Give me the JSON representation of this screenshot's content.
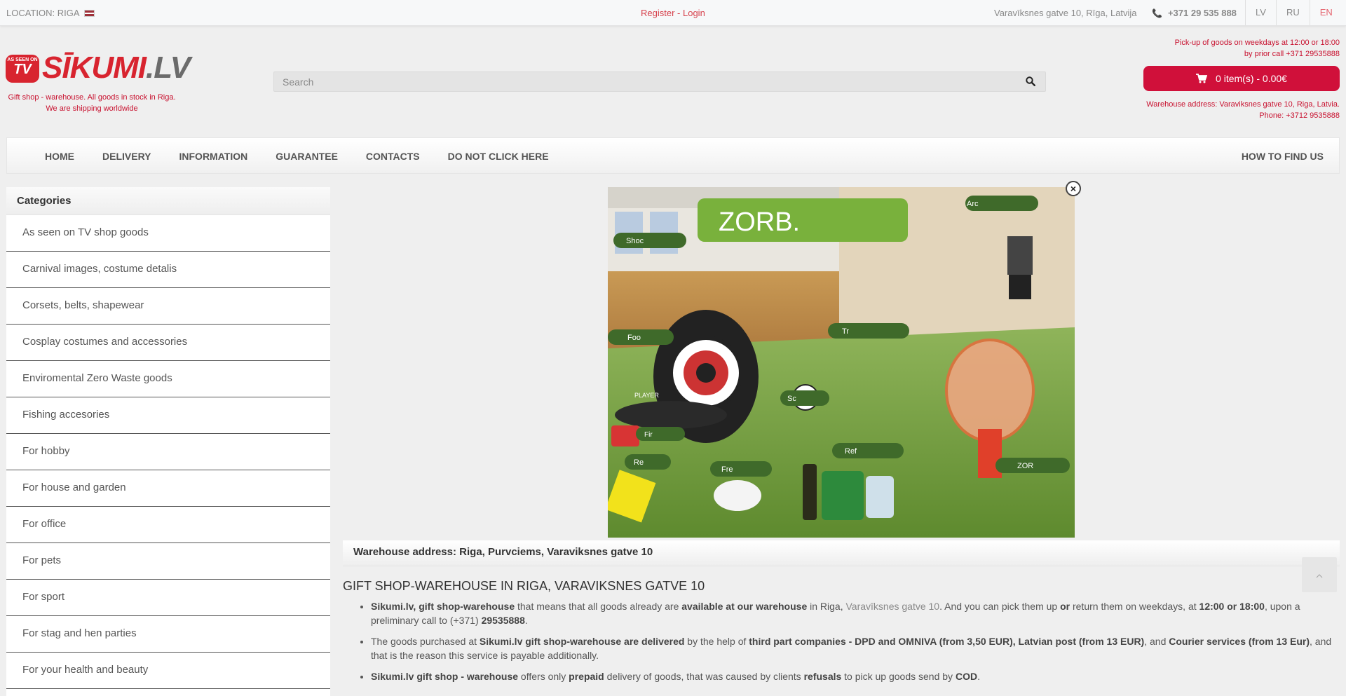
{
  "topbar": {
    "location": "LOCATION: RIGA",
    "register": "Register",
    "sep": " - ",
    "login": "Login",
    "address": "Varavīksnes gatve 10, Rīga, Latvija",
    "phone": "+371 29 535 888",
    "langs": [
      "LV",
      "RU",
      "EN"
    ],
    "active_lang": "EN"
  },
  "header": {
    "logo_small": "AS SEEN ON",
    "logo_tv": "TV",
    "logo_main": "SĪKUMI",
    "logo_suffix": ".LV",
    "tagline_1": "Gift shop - warehouse. All goods in stock in Riga.",
    "tagline_2": "We are shipping worldwide",
    "search_placeholder": "Search",
    "pickup_1": "Pick-up of goods on weekdays at 12:00 or 18:00",
    "pickup_2": "by prior call +371 29535888",
    "cart_label": "0 item(s) - 0.00€",
    "warehouse_1": "Warehouse address: Varaviksnes gatve 10, Riga, Latvia.",
    "warehouse_2": "Phone: +3712 9535888"
  },
  "nav": {
    "items": [
      "HOME",
      "DELIVERY",
      "INFORMATION",
      "GUARANTEE",
      "CONTACTS",
      "DO NOT CLICK HERE"
    ],
    "right": "HOW TO FIND US"
  },
  "sidebar": {
    "title": "Categories",
    "items": [
      "As seen on TV shop goods",
      "Carnival images, costume detalis",
      "Corsets, belts, shapewear",
      "Cosplay costumes and accessories",
      "Enviromental Zero Waste goods",
      "Fishing accesories",
      "For hobby",
      "For house and garden",
      "For office",
      "For pets",
      "For sport",
      "For stag and hen parties",
      "For your health and beauty"
    ]
  },
  "banner": {
    "headline": "ZORB.",
    "bubbles": [
      "Shoc",
      "Arc",
      "Foo",
      "Tr",
      "Sc",
      "Fir",
      "Re",
      "Fre",
      "Ref",
      "ZOR"
    ],
    "dart_text": "PLAYER",
    "close": "×"
  },
  "main": {
    "warehouse_bar": "Warehouse address: Riga, Purvciems, Varaviksnes gatve 10",
    "heading": "GIFT SHOP-WAREHOUSE IN RIGA, VARAVIKSNES GATVE 10",
    "p1": {
      "a": "Sikumi.lv, gift shop-warehouse",
      "b": " that means that all goods already are ",
      "c": "available at our warehouse",
      "d": " in Riga, ",
      "e": "Varavīksnes gatve 10",
      "f": ". And you can pick them up ",
      "g": "or",
      "h": " return them  on weekdays, at ",
      "i": "12:00 or 18:00",
      "j": ", upon a preliminary call to (+371) ",
      "k": "29535888",
      "l": "."
    },
    "p2": {
      "a": "The goods purchased at ",
      "b": "Sikumi.lv gift shop-warehouse are delivered",
      "c": " by the help of ",
      "d": "third part companies - DPD and OMNIVA (from 3,50 EUR), Latvian post (from 13 EUR)",
      "e": ", and ",
      "f": "Courier services (from 13 Eur)",
      "g": ", and that is the reason this service is payable additionally."
    },
    "p3": {
      "a": "Sikumi.lv gift shop - warehouse",
      "b": " offers only ",
      "c": "prepaid",
      "d": " delivery of goods, that was caused by clients ",
      "e": "refusals",
      "f": " to pick up goods send by ",
      "g": "COD",
      "h": "."
    }
  },
  "colors": {
    "accent": "#d0103a",
    "link_red": "#c8102e"
  }
}
